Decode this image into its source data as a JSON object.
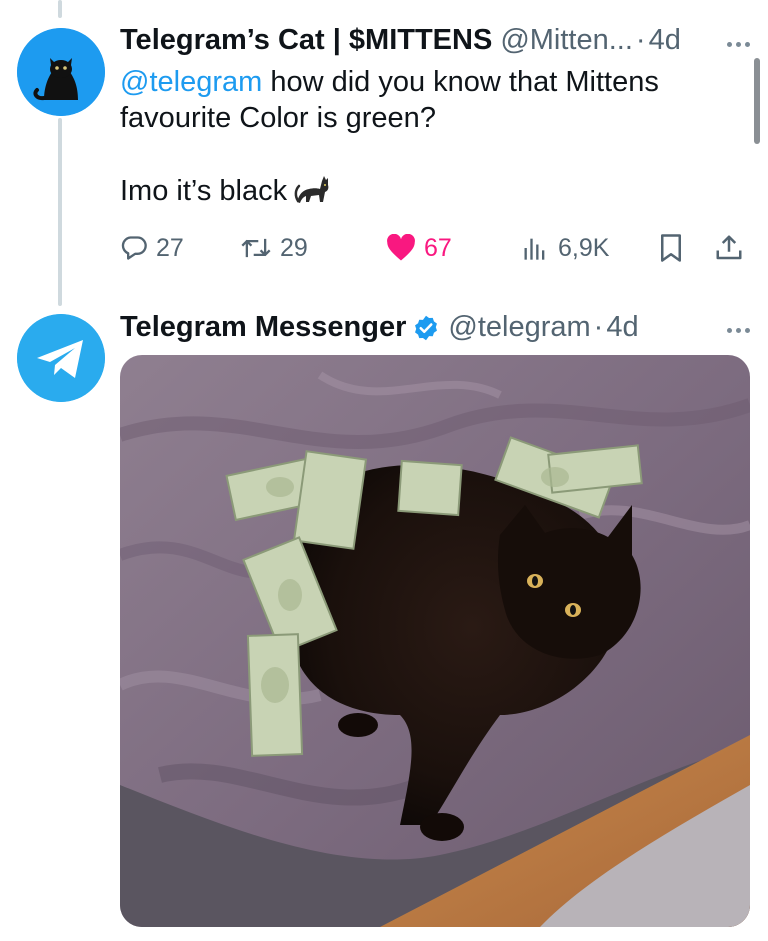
{
  "tweet1": {
    "display_name": "Telegram’s Cat | $MITTENS",
    "handle": "@Mitten...",
    "separator": "·",
    "time": "4d",
    "text": {
      "mention": "@telegram",
      "line1_rest": " how did you know that Mittens",
      "line2": "favourite Color is green?",
      "line3": "Imo it’s black"
    },
    "stats": {
      "replies": "27",
      "reposts": "29",
      "likes": "67",
      "views": "6,9K"
    },
    "liked": true,
    "avatar_icon": "black-cat-avatar"
  },
  "tweet2": {
    "display_name": "Telegram Messenger",
    "handle": "@telegram",
    "separator": "·",
    "time": "4d",
    "verified": true,
    "avatar_icon": "telegram-paper-plane-logo",
    "media": {
      "type": "photo",
      "subject": "black cat lying on a purple blanket surrounded by 100 dollar bills"
    }
  },
  "colors": {
    "accent": "#1d9bf0",
    "like": "#f91880",
    "secondary_text": "#536471",
    "primary_text": "#0f1419",
    "telegram_blue": "#2aabee"
  }
}
